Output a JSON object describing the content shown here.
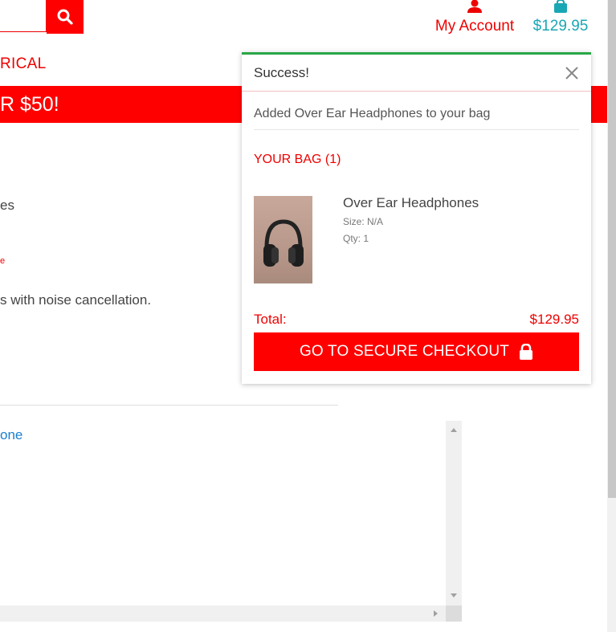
{
  "header": {
    "account_label": "My Account",
    "bag_total": "$129.95"
  },
  "nav": {
    "category_fragment": "RICAL"
  },
  "promo": {
    "text_fragment": "R $50!"
  },
  "product_page": {
    "fragment_1": "es",
    "fragment_small": "e",
    "description_fragment": "s with noise cancellation.",
    "link_fragment": "one"
  },
  "toast": {
    "title": "Success!",
    "message": "Added Over Ear Headphones to your bag",
    "bag_heading": "YOUR BAG (1)",
    "item": {
      "name": "Over Ear Headphones",
      "size": "Size: N/A",
      "qty": "Qty: 1"
    },
    "total_label": "Total:",
    "total_value": "$129.95",
    "checkout_label": "GO TO SECURE CHECKOUT"
  },
  "colors": {
    "brand_red": "#ff0000",
    "bag_teal": "#1aa7b4",
    "success_green": "#28a745"
  },
  "icons": {
    "search": "search-icon",
    "account": "user-icon",
    "bag": "shopping-bag-icon",
    "close": "close-icon",
    "lock": "lock-icon"
  }
}
